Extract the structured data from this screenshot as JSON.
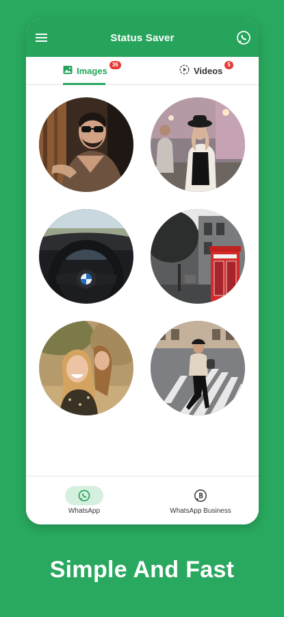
{
  "colors": {
    "background": "#29a85f",
    "accent": "#27a45c",
    "badge": "#e53935"
  },
  "app_bar": {
    "title": "Status Saver",
    "menu_icon": "menu-icon",
    "action_icon": "whatsapp-icon"
  },
  "tabs": [
    {
      "label": "Images",
      "badge": "36",
      "icon": "image-icon",
      "selected": true
    },
    {
      "label": "Videos",
      "badge": "5",
      "icon": "play-circle-icon",
      "selected": false
    }
  ],
  "thumbnails": [
    {
      "subject": "man-in-sunglasses"
    },
    {
      "subject": "woman-in-hat-street"
    },
    {
      "subject": "bmw-steering-wheel"
    },
    {
      "subject": "red-telephone-booth"
    },
    {
      "subject": "smiling-women"
    },
    {
      "subject": "woman-crosswalk"
    }
  ],
  "bottom_nav": [
    {
      "label": "WhatsApp",
      "icon": "whatsapp-icon",
      "selected": true
    },
    {
      "label": "WhatsApp Business",
      "icon": "whatsapp-business-icon",
      "selected": false
    }
  ],
  "tagline": "Simple And Fast"
}
